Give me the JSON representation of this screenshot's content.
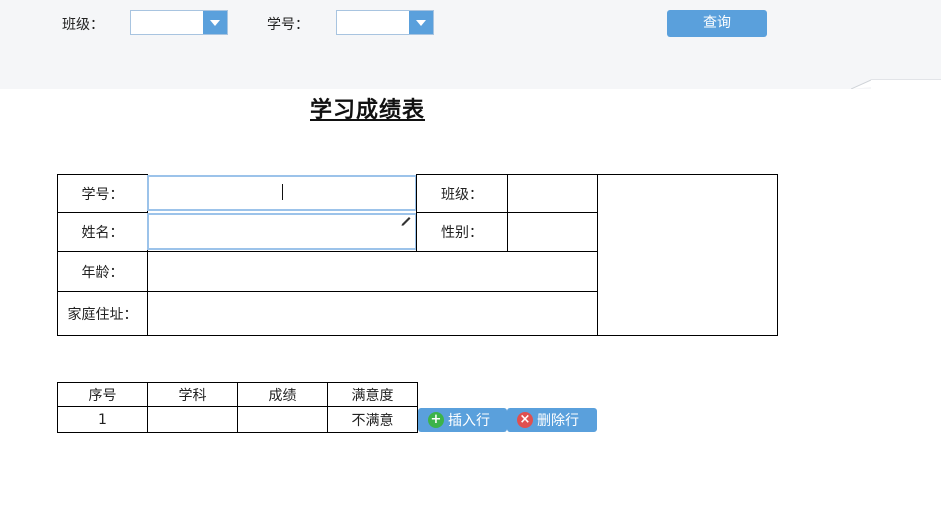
{
  "filter": {
    "class_label": "班级：",
    "student_no_label": "学号：",
    "query_button": "查询"
  },
  "form": {
    "title": "学习成绩表",
    "student_no_label": "学号：",
    "class_label": "班级：",
    "name_label": "姓名：",
    "gender_label": "性别：",
    "age_label": "年龄：",
    "address_label": "家庭住址："
  },
  "grades": {
    "headers": [
      "序号",
      "学科",
      "成绩",
      "满意度"
    ],
    "rows": [
      [
        "1",
        "",
        "",
        "不满意"
      ]
    ]
  },
  "actions": {
    "insert_row": "插入行",
    "delete_row": "删除行"
  },
  "colors": {
    "accent": "#5aa0dc",
    "topbar_bg": "#f5f6f8",
    "delete_icon": "#e05050",
    "insert_icon": "#3cb34a"
  }
}
